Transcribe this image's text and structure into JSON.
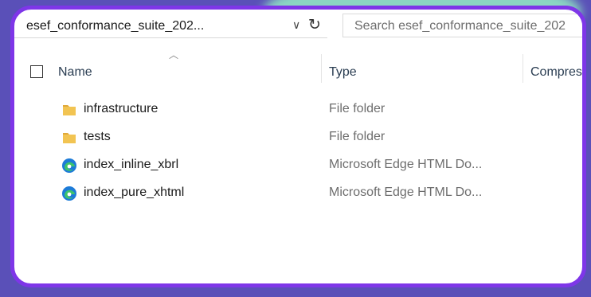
{
  "addressbar": {
    "path": "esef_conformance_suite_202..."
  },
  "search": {
    "placeholder": "Search esef_conformance_suite_202"
  },
  "columns": {
    "name": "Name",
    "type": "Type",
    "compressed": "Compres"
  },
  "files": [
    {
      "name": "infrastructure",
      "type": "File folder",
      "icon": "folder-icon"
    },
    {
      "name": "tests",
      "type": "File folder",
      "icon": "folder-icon"
    },
    {
      "name": "index_inline_xbrl",
      "type": "Microsoft Edge HTML Do...",
      "icon": "edge-icon"
    },
    {
      "name": "index_pure_xhtml",
      "type": "Microsoft Edge HTML Do...",
      "icon": "edge-icon"
    }
  ],
  "colors": {
    "frame_border": "#7e36e8",
    "background": "#5a50b8",
    "folder": "#f2c452"
  }
}
